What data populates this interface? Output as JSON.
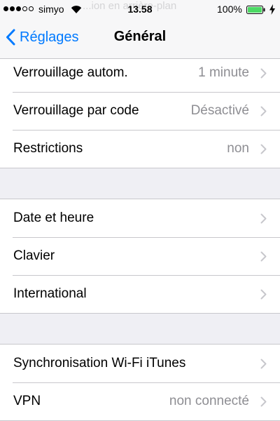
{
  "status_bar": {
    "carrier": "simyo",
    "time": "13.58",
    "battery_percent": "100%",
    "signal_full": 3,
    "signal_total": 5,
    "background_text": "...ion en arrière-plan",
    "battery_color": "#4cd964",
    "icons": [
      "signal-dots-icon",
      "wifi-icon",
      "battery-icon",
      "charging-bolt-icon"
    ]
  },
  "nav": {
    "back_label": "Réglages",
    "title": "Général",
    "accent_color": "#007aff"
  },
  "groups": [
    {
      "rows": [
        {
          "id": "auto-lock",
          "label": "Verrouillage autom.",
          "value": "1 minute"
        },
        {
          "id": "passcode-lock",
          "label": "Verrouillage par code",
          "value": "Désactivé"
        },
        {
          "id": "restrictions",
          "label": "Restrictions",
          "value": "non"
        }
      ]
    },
    {
      "rows": [
        {
          "id": "date-time",
          "label": "Date et heure",
          "value": ""
        },
        {
          "id": "keyboard",
          "label": "Clavier",
          "value": ""
        },
        {
          "id": "international",
          "label": "International",
          "value": ""
        }
      ]
    },
    {
      "rows": [
        {
          "id": "itunes-wifi-sync",
          "label": "Synchronisation Wi-Fi iTunes",
          "value": ""
        },
        {
          "id": "vpn",
          "label": "VPN",
          "value": "non connecté"
        }
      ]
    }
  ]
}
